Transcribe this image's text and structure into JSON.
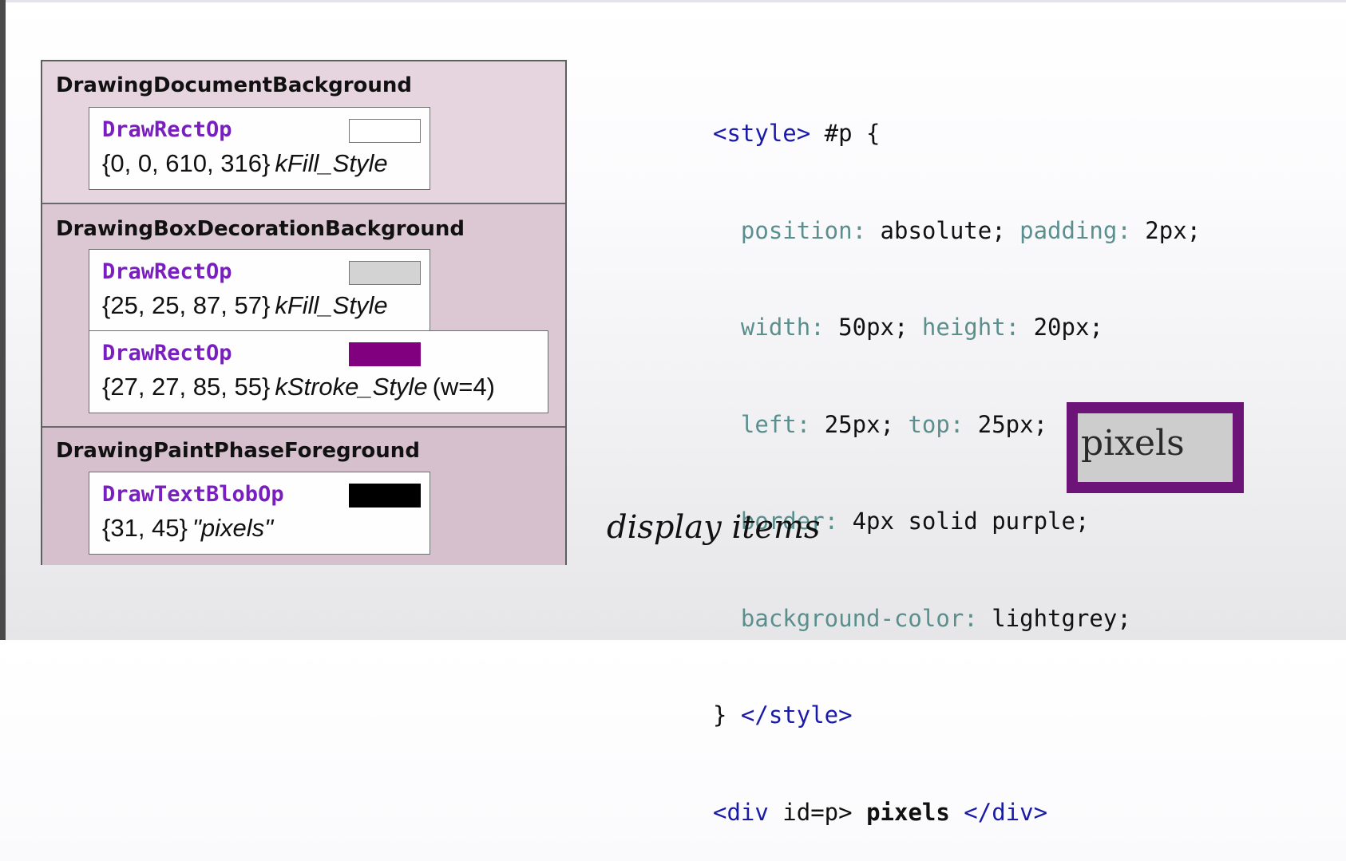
{
  "groups": [
    {
      "title": "DrawingDocumentBackground",
      "ops": [
        {
          "name": "DrawRectOp",
          "args": "{0, 0, 610, 316}",
          "style": "kFill_Style",
          "extra": "",
          "swatch_color": "#ffffff"
        }
      ]
    },
    {
      "title": "DrawingBoxDecorationBackground",
      "ops": [
        {
          "name": "DrawRectOp",
          "args": "{25, 25, 87, 57}",
          "style": "kFill_Style",
          "extra": "",
          "swatch_color": "#d3d3d3"
        },
        {
          "name": "DrawRectOp",
          "args": "{27, 27, 85, 55}",
          "style": "kStroke_Style",
          "extra": "(w=4)",
          "swatch_color": "#800080"
        }
      ]
    },
    {
      "title": "DrawingPaintPhaseForeground",
      "ops": [
        {
          "name": "DrawTextBlobOp",
          "args": "{31, 45}",
          "style": "\"pixels\"",
          "extra": "",
          "swatch_color": "#000000"
        }
      ]
    }
  ],
  "code": {
    "l1_open": "<style>",
    "l1_rest": " #p {",
    "l2_p1": "position:",
    "l2_v1": " absolute; ",
    "l2_p2": "padding:",
    "l2_v2": " 2px;",
    "l3_p1": "width:",
    "l3_v1": " 50px; ",
    "l3_p2": "height:",
    "l3_v2": " 20px;",
    "l4_p1": "left:",
    "l4_v1": " 25px; ",
    "l4_p2": "top:",
    "l4_v2": " 25px;",
    "l5_p1": "border:",
    "l5_v1": " 4px solid purple;",
    "l6_p1": "background-color:",
    "l6_v1": " lightgrey;",
    "l7_brace": "} ",
    "l7_close": "</style>",
    "l8_open": "<div",
    "l8_attr": " id=p> ",
    "l8_text": "pixels",
    "l8_close": " </div>"
  },
  "caption": "display items",
  "preview": {
    "text": "pixels",
    "border_color": "#6c1478",
    "background_color": "#cdcdcd"
  },
  "colors": {
    "op_name": "#7a1fbf",
    "code_tag": "#1a1aa8",
    "code_property": "#5a8f8e"
  }
}
